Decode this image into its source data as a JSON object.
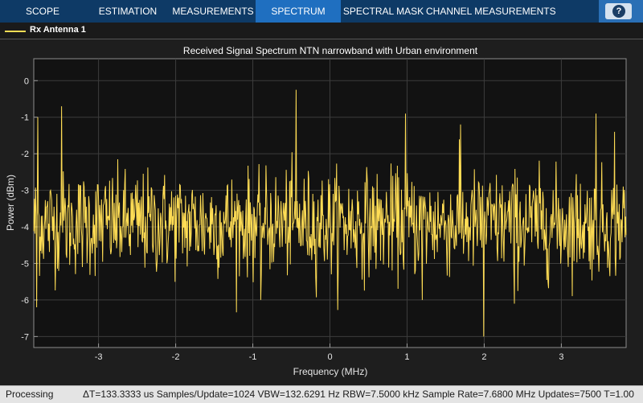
{
  "toolbar": {
    "tabs": [
      {
        "label": "SCOPE",
        "active": false
      },
      {
        "label": "ESTIMATION",
        "active": false
      },
      {
        "label": "MEASUREMENTS",
        "active": false
      },
      {
        "label": "SPECTRUM",
        "active": true
      },
      {
        "label": "SPECTRAL MASK",
        "active": false
      },
      {
        "label": "CHANNEL MEASUREMENTS",
        "active": false
      }
    ],
    "help_icon": "question-circle-icon",
    "help_glyph": "?"
  },
  "legend": {
    "label": "Rx Antenna 1",
    "color": "#ffdd55"
  },
  "colors": {
    "toolbar": "#0e3a66",
    "active_tab": "#1f6fc0",
    "plot_bg": "#121212",
    "trace": "#ffdd55"
  },
  "chart_data": {
    "type": "line",
    "title": "Received Signal Spectrum NTN narrowband with Urban environment",
    "xlabel": "Frequency (MHz)",
    "ylabel": "Power (dBm)",
    "xlim": [
      -3.84,
      3.84
    ],
    "ylim": [
      -7.3,
      0.6
    ],
    "xticks": [
      -3,
      -2,
      -1,
      0,
      1,
      2,
      3
    ],
    "yticks": [
      0,
      -1,
      -2,
      -3,
      -4,
      -5,
      -6,
      -7
    ],
    "grid": true,
    "legend_position": "top-left",
    "num_points": 1024,
    "noise_floor_dbm": -3.9,
    "series": [
      {
        "name": "Rx Antenna 1",
        "color": "#ffdd55",
        "peaks": [
          {
            "x": -3.79,
            "y": -1.0
          },
          {
            "x": -3.48,
            "y": -0.7
          },
          {
            "x": -0.44,
            "y": -0.25
          },
          {
            "x": 0.98,
            "y": -0.9
          },
          {
            "x": 1.69,
            "y": -1.2
          },
          {
            "x": 3.45,
            "y": -0.9
          },
          {
            "x": 3.69,
            "y": -1.4
          }
        ],
        "troughs": [
          {
            "x": -3.8,
            "y": -6.2
          },
          {
            "x": 1.99,
            "y": -7.0
          },
          {
            "x": 2.39,
            "y": -6.1
          },
          {
            "x": -0.9,
            "y": -6.0
          },
          {
            "x": 1.2,
            "y": -6.0
          }
        ]
      }
    ]
  },
  "status": {
    "state": "Processing",
    "info": "ΔT=133.3333 us  Samples/Update=1024  VBW=132.6291 Hz  RBW=7.5000 kHz  Sample Rate=7.6800 MHz  Updates=7500  T=1.00"
  }
}
